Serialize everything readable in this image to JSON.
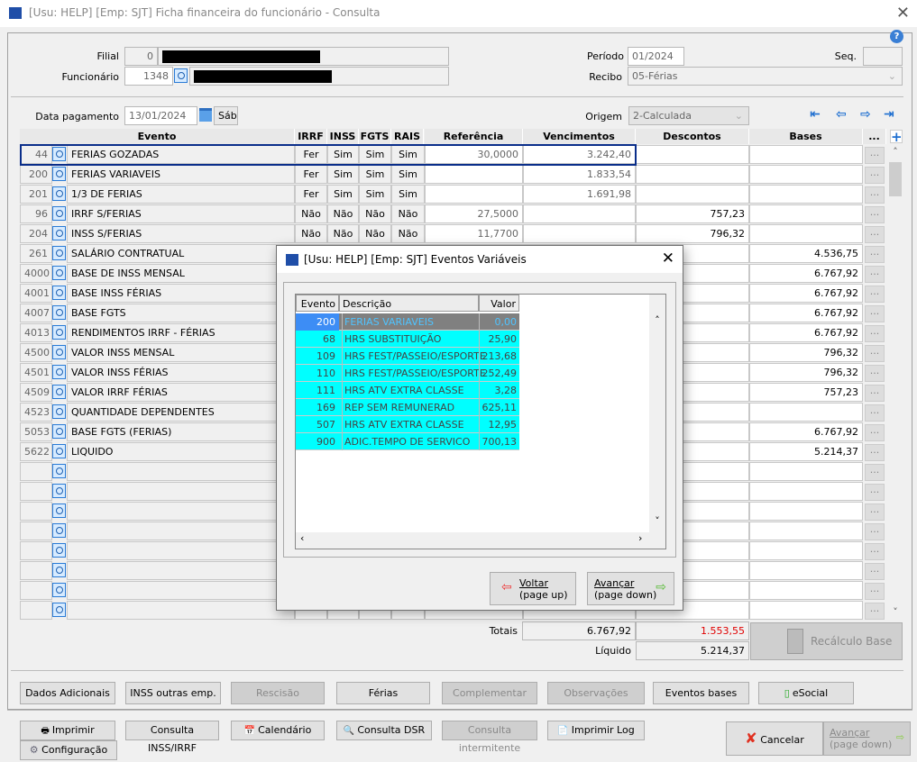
{
  "window": {
    "title": "[Usu: HELP] [Emp: SJT] Ficha financeira do funcionário - Consulta",
    "close": "✕"
  },
  "header": {
    "filial_label": "Filial",
    "filial_value": "0",
    "funcionario_label": "Funcionário",
    "funcionario_value": "1348",
    "periodo_label": "Período",
    "periodo_value": "01/2024",
    "seq_label": "Seq.",
    "seq_value": "",
    "recibo_label": "Recibo",
    "recibo_value": "05-Férias",
    "data_pagamento_label": "Data pagamento",
    "data_pagamento_value": "13/01/2024",
    "weekday": "Sáb",
    "origem_label": "Origem",
    "origem_value": "2-Calculada"
  },
  "grid": {
    "columns": [
      "Evento",
      "IRRF",
      "INSS",
      "FGTS",
      "RAIS",
      "Referência",
      "Vencimentos",
      "Descontos",
      "Bases",
      "..."
    ],
    "rows": [
      {
        "code": "44",
        "desc": "FERIAS GOZADAS",
        "irrf": "Fer",
        "inss": "Sim",
        "fgts": "Sim",
        "rais": "Sim",
        "ref": "30,0000",
        "venc": "3.242,40",
        "descontos": "",
        "bases": ""
      },
      {
        "code": "200",
        "desc": "FERIAS VARIAVEIS",
        "irrf": "Fer",
        "inss": "Sim",
        "fgts": "Sim",
        "rais": "Sim",
        "ref": "",
        "venc": "1.833,54",
        "descontos": "",
        "bases": ""
      },
      {
        "code": "201",
        "desc": "1/3 DE FERIAS",
        "irrf": "Fer",
        "inss": "Sim",
        "fgts": "Sim",
        "rais": "Sim",
        "ref": "",
        "venc": "1.691,98",
        "descontos": "",
        "bases": ""
      },
      {
        "code": "96",
        "desc": "IRRF S/FERIAS",
        "irrf": "Não",
        "inss": "Não",
        "fgts": "Não",
        "rais": "Não",
        "ref": "27,5000",
        "venc": "",
        "descontos": "757,23",
        "bases": ""
      },
      {
        "code": "204",
        "desc": "INSS S/FERIAS",
        "irrf": "Não",
        "inss": "Não",
        "fgts": "Não",
        "rais": "Não",
        "ref": "11,7700",
        "venc": "",
        "descontos": "796,32",
        "bases": ""
      },
      {
        "code": "261",
        "desc": "SALÁRIO CONTRATUAL",
        "bases": "4.536,75"
      },
      {
        "code": "4000",
        "desc": "BASE DE INSS MENSAL",
        "bases": "6.767,92"
      },
      {
        "code": "4001",
        "desc": "BASE INSS FÉRIAS",
        "bases": "6.767,92"
      },
      {
        "code": "4007",
        "desc": "BASE FGTS",
        "bases": "6.767,92"
      },
      {
        "code": "4013",
        "desc": "RENDIMENTOS IRRF - FÉRIAS",
        "bases": "6.767,92"
      },
      {
        "code": "4500",
        "desc": "VALOR INSS MENSAL",
        "bases": "796,32"
      },
      {
        "code": "4501",
        "desc": "VALOR INSS FÉRIAS",
        "bases": "796,32"
      },
      {
        "code": "4509",
        "desc": "VALOR IRRF FÉRIAS",
        "bases": "757,23"
      },
      {
        "code": "4523",
        "desc": "QUANTIDADE DEPENDENTES",
        "bases": ""
      },
      {
        "code": "5053",
        "desc": "BASE FGTS (FERIAS)",
        "bases": "6.767,92"
      },
      {
        "code": "5622",
        "desc": "LIQUIDO",
        "bases": "5.214,37"
      }
    ],
    "empty_rows": 8,
    "dots": "..."
  },
  "totals": {
    "label": "Totais",
    "vencimentos": "6.767,92",
    "descontos": "1.553,55",
    "liquido_label": "Líquido",
    "liquido": "5.214,37",
    "recalc_label": "Recálculo Base"
  },
  "buttons_row1": [
    "Dados Adicionais",
    "INSS outras emp.",
    "Rescisão",
    "Férias",
    "Complementar",
    "Observações",
    "Eventos bases",
    "eSocial"
  ],
  "buttons_row2": [
    "Imprimir",
    "Consulta INSS/IRRF",
    "Calendário",
    "Consulta DSR",
    "Consulta intermitente",
    "Imprimir Log"
  ],
  "config_label": "Configuração",
  "cancel_label": "Cancelar",
  "advance_label": "Avançar",
  "advance_sub": "(page down)",
  "dialog": {
    "title": "[Usu: HELP] [Emp: SJT] Eventos Variáveis",
    "columns": [
      "Evento",
      "Descrição",
      "Valor"
    ],
    "rows": [
      {
        "code": "200",
        "desc": "FERIAS VARIAVEIS",
        "valor": "0,00"
      },
      {
        "code": "68",
        "desc": "HRS SUBSTITUIÇÃO",
        "valor": "25,90"
      },
      {
        "code": "109",
        "desc": "HRS FEST/PASSEIO/ESPORTE",
        "valor": "213,68"
      },
      {
        "code": "110",
        "desc": "HRS FEST/PASSEIO/ESPORTE",
        "valor": "252,49"
      },
      {
        "code": "111",
        "desc": "HRS ATV EXTRA CLASSE",
        "valor": "3,28"
      },
      {
        "code": "169",
        "desc": "REP SEM REMUNERAD",
        "valor": "625,11"
      },
      {
        "code": "507",
        "desc": "HRS ATV EXTRA CLASSE",
        "valor": "12,95"
      },
      {
        "code": "900",
        "desc": "ADIC.TEMPO DE SERVICO",
        "valor": "700,13"
      }
    ],
    "back_label": "Voltar",
    "back_sub": "(page up)",
    "next_label": "Avançar",
    "next_sub": "(page down)"
  },
  "colors": {
    "accent": "#1f4ea8",
    "selected_border": "#0a2e8a",
    "cyan": "#00ffff",
    "red_total": "#e00000"
  }
}
